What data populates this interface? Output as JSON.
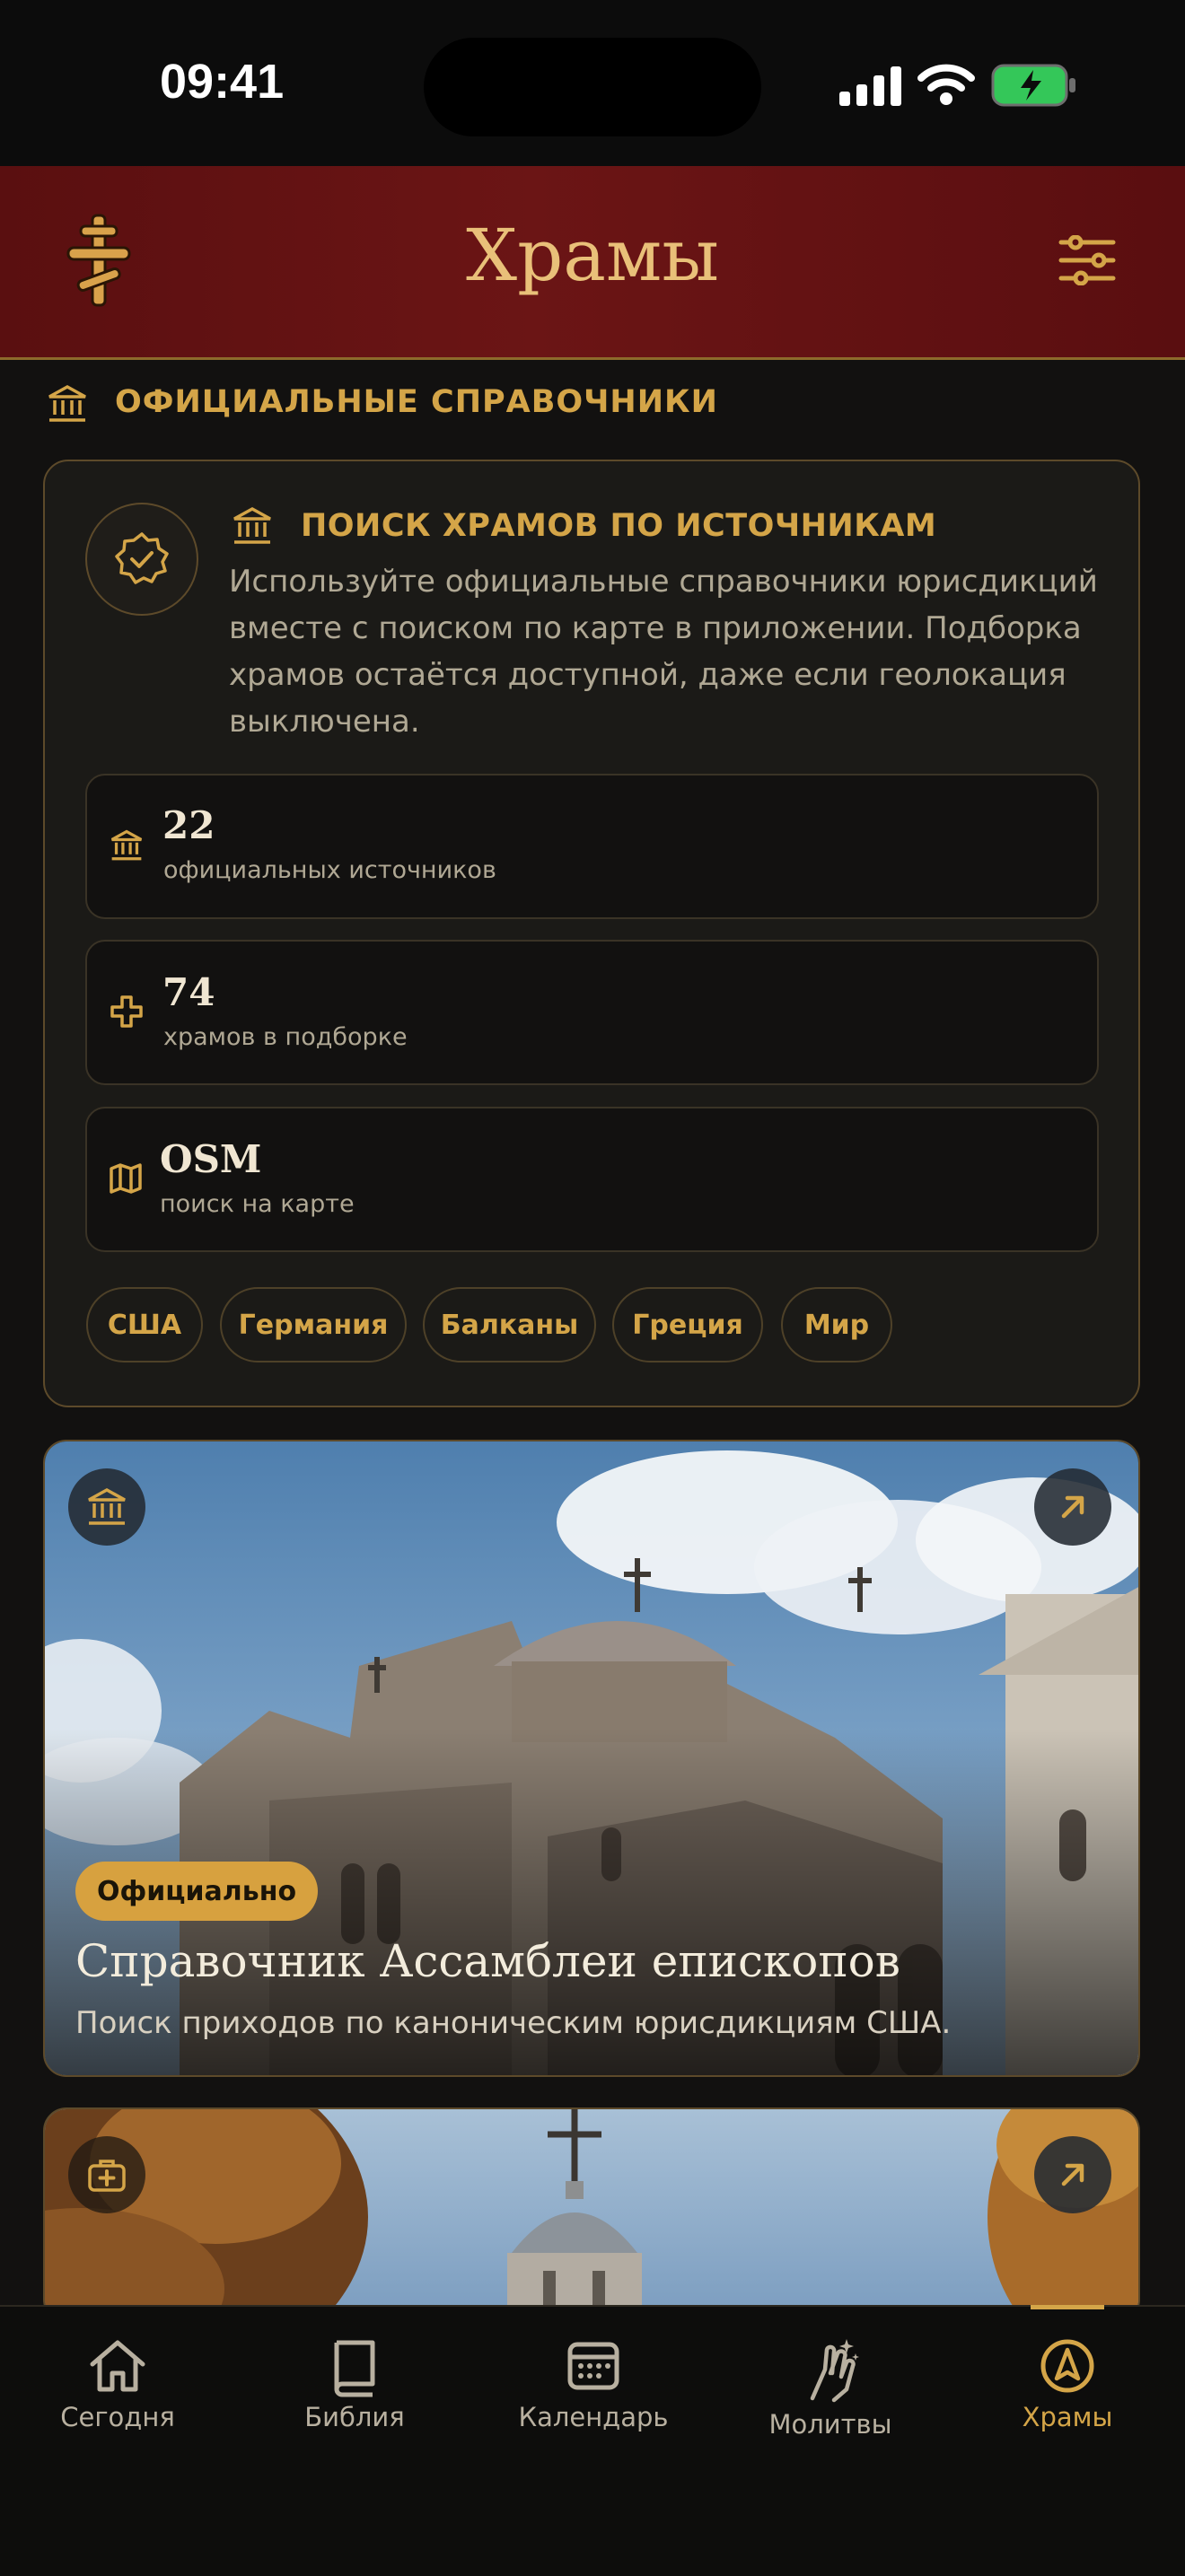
{
  "status_bar": {
    "time": "09:41"
  },
  "header": {
    "title": "Храмы",
    "logo_icon": "orthodox-cross-icon",
    "settings_icon": "sliders-icon"
  },
  "section": {
    "title": "ОФИЦИАЛЬНЫЕ СПРАВОЧНИКИ",
    "icon": "institution-icon"
  },
  "info_card": {
    "title": "ПОИСК ХРАМОВ ПО ИСТОЧНИКАМ",
    "description": "Используйте официальные справочники юрисдикций вместе с поиском по карте в приложении. Подборка храмов остаётся доступной, даже если геолокация выключена.",
    "stats": [
      {
        "value": "22",
        "label": "официальных источников",
        "icon": "institution-icon"
      },
      {
        "value": "74",
        "label": "храмов в подборке",
        "icon": "cross-icon"
      },
      {
        "value": "OSM",
        "label": "поиск на карте",
        "icon": "map-icon"
      }
    ],
    "chips": [
      "США",
      "Германия",
      "Балканы",
      "Греция",
      "Мир"
    ]
  },
  "feature_cards": [
    {
      "badge": "Официально",
      "title": "Справочник Ассамблеи епископов",
      "subtitle": "Поиск приходов по каноническим юрисдикциям США.",
      "icon": "institution-icon",
      "action_icon": "arrow-up-right-icon"
    },
    {
      "icon": "first-aid-icon",
      "action_icon": "arrow-up-right-icon"
    }
  ],
  "tabs": [
    {
      "label": "Сегодня",
      "icon": "home-icon",
      "active": false
    },
    {
      "label": "Библия",
      "icon": "book-icon",
      "active": false
    },
    {
      "label": "Календарь",
      "icon": "calendar-icon",
      "active": false
    },
    {
      "label": "Молитвы",
      "icon": "praying-hands-icon",
      "active": false
    },
    {
      "label": "Храмы",
      "icon": "compass-icon",
      "active": true
    }
  ],
  "colors": {
    "accent": "#d4a548",
    "header_bg": "#5a0f10",
    "background": "#121110"
  }
}
